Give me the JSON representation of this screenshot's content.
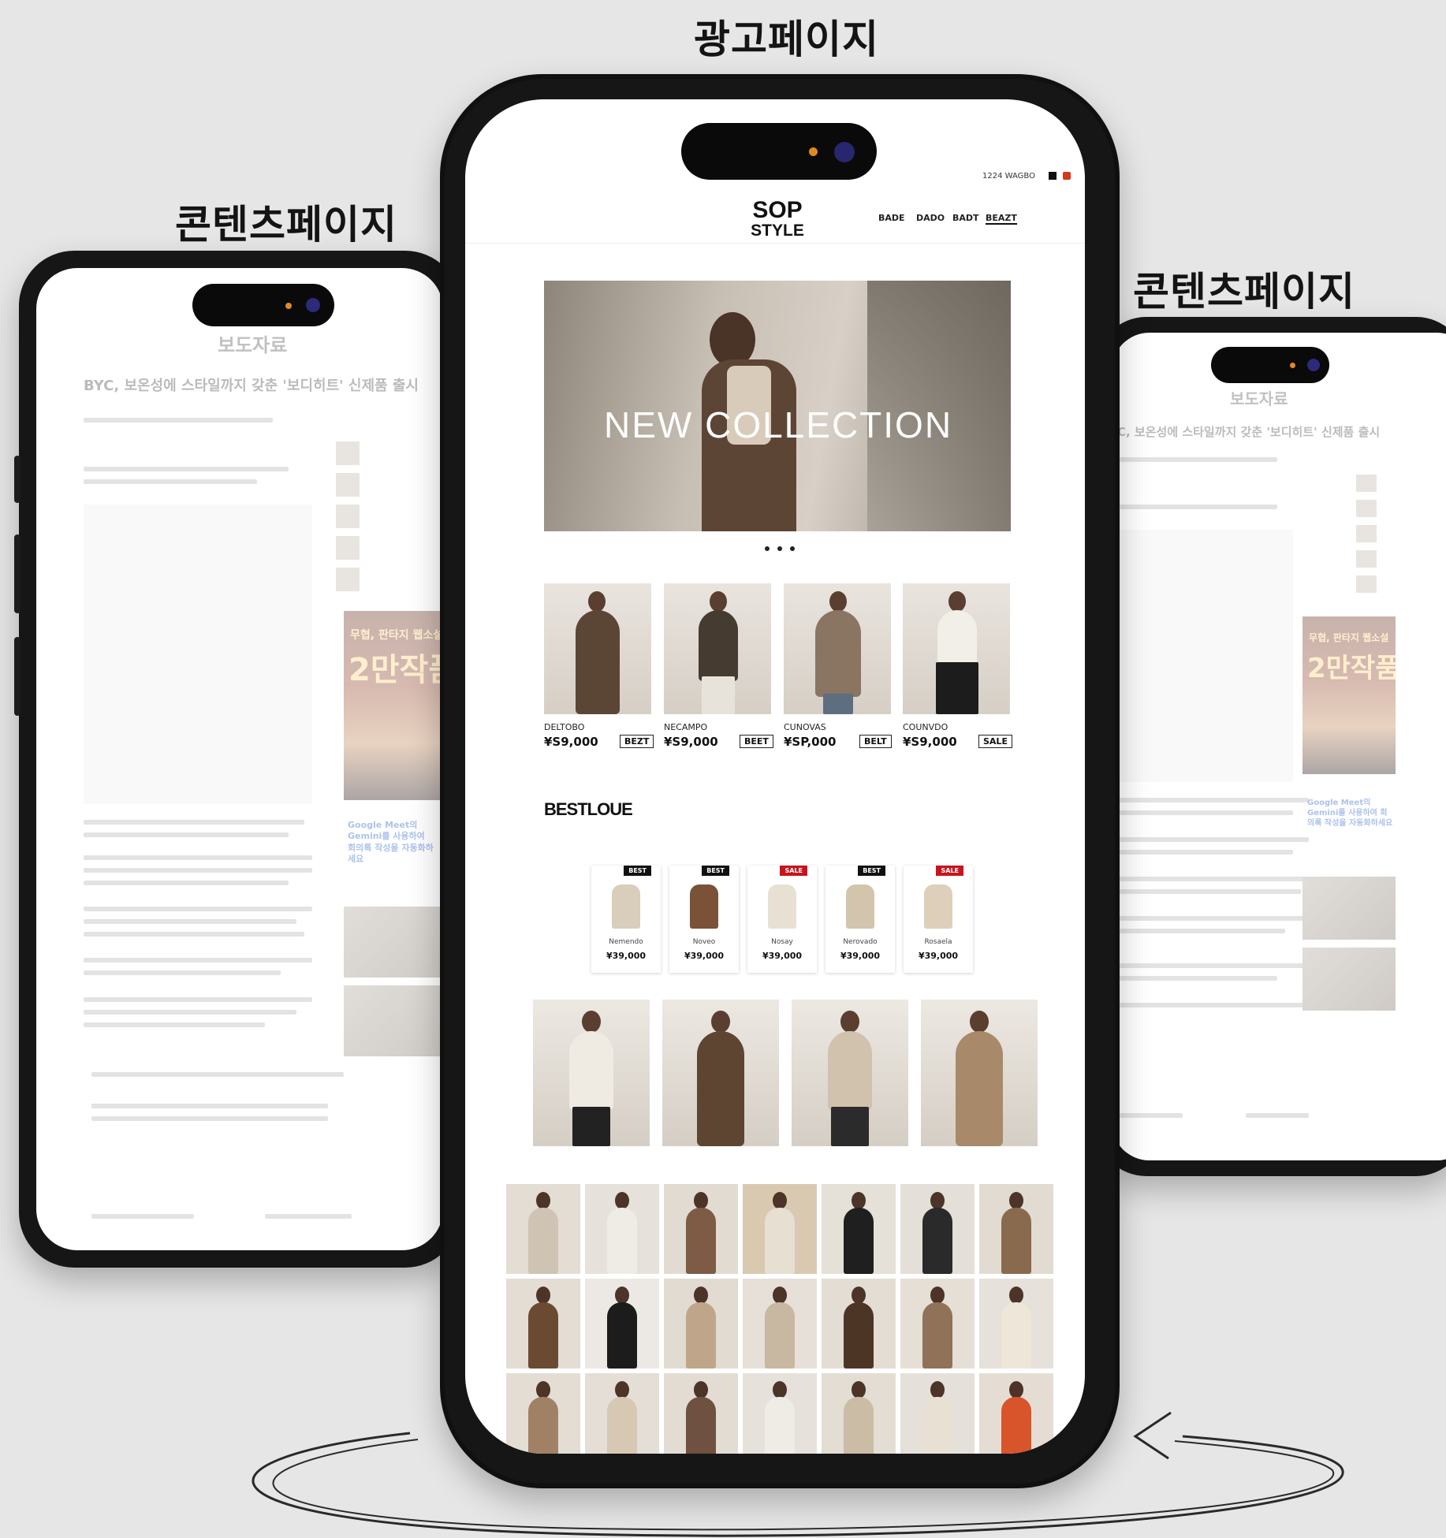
{
  "labels": {
    "ad_page": "광고페이지",
    "content_left": "콘텐츠페이지",
    "content_right": "콘텐츠페이지"
  },
  "content_page": {
    "press_title": "보도자료",
    "article_title": "BYC, 보온성에 스타일까지 갖춘 '보디히트' 신제품 출시",
    "ad_big_text": "2만작품",
    "ad_small_text": "무협, 판타지 웹소설",
    "google_ad": "Google Meet의 Gemini를 사용하여 회의록 작성을 자동화하세요"
  },
  "store": {
    "logo_line1": "SOP",
    "logo_line2": "STYLE",
    "nav": [
      "BADE",
      "DADO",
      "BADT",
      "BEAZT"
    ],
    "top_util": "1224  WAGBO",
    "hero_text": "NEW COLLECTION",
    "products": [
      {
        "name": "DELTOBO",
        "price": "¥S9,000",
        "tag": "BEZT"
      },
      {
        "name": "NECAMPO",
        "price": "¥S9,000",
        "tag": "BEET"
      },
      {
        "name": "CUNOVAS",
        "price": "¥SP,000",
        "tag": "BELT"
      },
      {
        "name": "COUNVDO",
        "price": "¥S9,000",
        "tag": "SALE"
      }
    ],
    "best_title": "BESTLOUE",
    "best_items": [
      {
        "badge": "BEST",
        "name": "Nemendo",
        "price": "¥39,000",
        "badge_color": "#111111"
      },
      {
        "badge": "BEST",
        "name": "Noveo",
        "price": "¥39,000",
        "badge_color": "#111111"
      },
      {
        "badge": "SALE",
        "name": "Nosay",
        "price": "¥39,000",
        "badge_color": "#c8141c"
      },
      {
        "badge": "BEST",
        "name": "Nerovado",
        "price": "¥39,000",
        "badge_color": "#111111"
      },
      {
        "badge": "SALE",
        "name": "Rosaela",
        "price": "¥39,000",
        "badge_color": "#c8141c"
      }
    ]
  },
  "colors": {
    "phone_frame": "#161616",
    "background": "#e6e6e6",
    "accent_red": "#c8141c"
  }
}
